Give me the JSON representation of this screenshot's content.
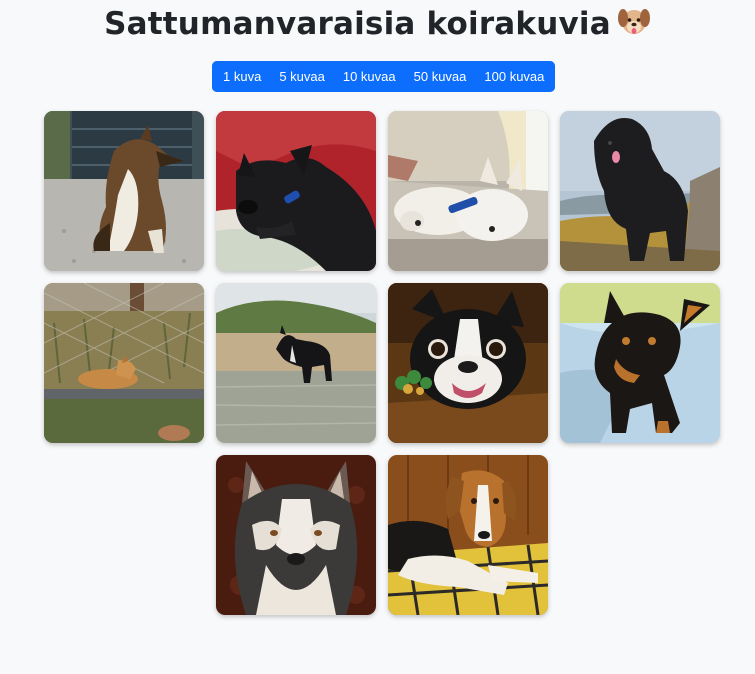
{
  "page": {
    "title": "Sattumanvaraisia koirakuvia",
    "title_icon": "dog-face-emoji"
  },
  "count_buttons": [
    {
      "label": "1 kuva"
    },
    {
      "label": "5 kuvaa"
    },
    {
      "label": "10 kuvaa"
    },
    {
      "label": "50 kuvaa"
    },
    {
      "label": "100 kuvaa"
    }
  ],
  "accent_color": "#0d6efd",
  "gallery": [
    {
      "subject": "rough collie sitting in front of a dark garage door"
    },
    {
      "subject": "black puppy with blue collar lying on a pillow against a red backdrop"
    },
    {
      "subject": "two white west highland terriers lying on a couch"
    },
    {
      "subject": "black shaggy dog standing on rocks by the water"
    },
    {
      "subject": "tan dingo-like dog lying behind a wire fence in a field"
    },
    {
      "subject": "black and white dog standing in shallow water at a beach"
    },
    {
      "subject": "boston terrier with a rope toy"
    },
    {
      "subject": "black and tan miniature pinscher on a blue blanket"
    },
    {
      "subject": "alaskan malamute close-up portrait"
    },
    {
      "subject": "beagle lying on a yellow plaid blanket"
    }
  ]
}
